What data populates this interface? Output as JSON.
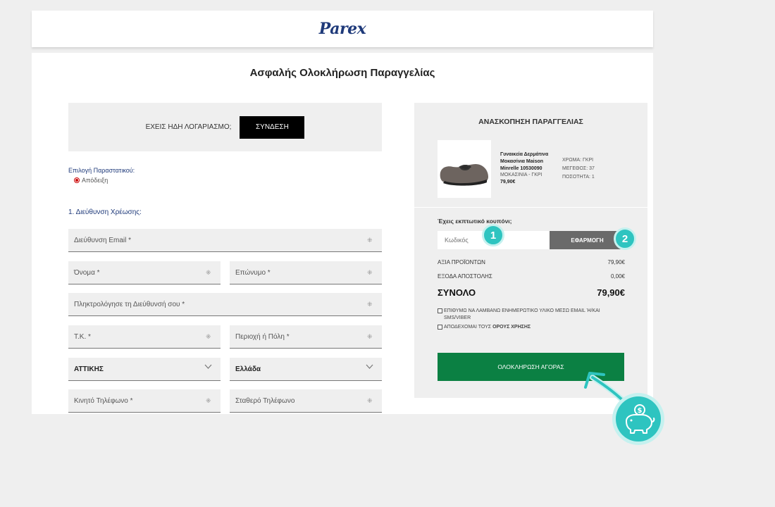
{
  "header": {
    "logo": "Parex"
  },
  "page_title": "Ασφαλής Ολοκλήρωση Παραγγελίας",
  "login": {
    "prompt": "ΕΧΕΙΣ ΗΔΗ ΛΟΓΑΡΙΑΣΜΟ;",
    "button": "ΣΥΝΔΕΣΗ"
  },
  "document_type": {
    "label": "Επιλογή Παραστατικού:",
    "selected": "Απόδειξη"
  },
  "billing": {
    "section_label": "1. Διεύθυνση Χρέωσης:",
    "email": "Διεύθυνση Email *",
    "first_name": "Όνομα *",
    "last_name": "Επώνυμο *",
    "address": "Πληκτρολόγησε τη Διεύθυνσή σου *",
    "postal_code": "Τ.Κ. *",
    "city": "Περιοχή ή Πόλη *",
    "region": "ΑΤΤΙΚΗΣ",
    "country": "Ελλάδα",
    "mobile": "Κινητό Τηλέφωνο *",
    "landline": "Σταθερό Τηλέφωνο"
  },
  "summary": {
    "title": "ΑΝΑΣΚΟΠΗΣΗ ΠΑΡΑΓΓΕΛΙΑΣ",
    "product": {
      "name": "Γυναικεία Δερμάτινα Μοκασίνια Maison Minrelle 10530090",
      "variant": "ΜΟΚΑΣΙΝΙΑ - ΓΚΡΙ",
      "price": "79,90€",
      "color": "ΧΡΩΜΑ: ΓΚΡΙ",
      "size": "ΜΕΓΕΘΟΣ: 37",
      "quantity": "ΠΟΣΟΤΗΤΑ: 1"
    }
  },
  "coupon": {
    "question": "Έχεις εκπτωτικό κουπόνι;",
    "placeholder": "Κωδικός",
    "apply": "ΕΦΑΡΜΟΓΗ"
  },
  "totals": {
    "products_label": "ΑΞΙΑ ΠΡΟΪΟΝΤΩΝ",
    "products_value": "79,90€",
    "shipping_label": "ΕΞΟΔΑ ΑΠΟΣΤΟΛΗΣ",
    "shipping_value": "0,00€",
    "total_label": "ΣΥΝΟΛΟ",
    "total_value": "79,90€"
  },
  "consents": {
    "newsletter": "ΕΠΙΘΥΜΩ ΝΑ ΛΑΜΒΑΝΩ ΕΝΗΜΕΡΩΤΙΚΟ ΥΛΙΚΟ ΜΕΣΩ EMAIL Ή/ΚΑΙ SMS/VIBER",
    "terms_prefix": "ΑΠΟΔΕΧΟΜΑΙ ΤΟΥΣ",
    "terms_link": "ΟΡΟΥΣ ΧΡΗΣΗΣ"
  },
  "checkout_button": "ΟΛΟΚΛΗΡΩΣΗ ΑΓΟΡΑΣ",
  "annotations": {
    "badge_1": "1",
    "badge_2": "2"
  },
  "colors": {
    "accent_teal": "#2ec4c0",
    "checkout_green": "#0b8043",
    "brand_blue": "#1f3a7a"
  }
}
